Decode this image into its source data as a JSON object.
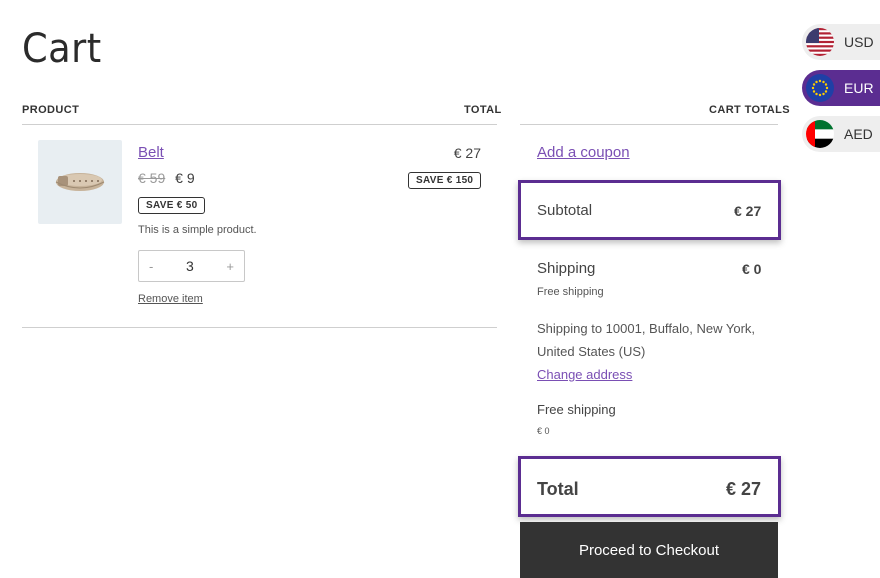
{
  "page": {
    "title": "Cart"
  },
  "table": {
    "col_product": "PRODUCT",
    "col_total": "TOTAL"
  },
  "item": {
    "name": "Belt",
    "price_old": "€ 59",
    "price_new": "€ 9",
    "save_badge": "SAVE € 50",
    "description": "This is a simple product.",
    "quantity": "3",
    "qty_minus": "-",
    "qty_plus": "+",
    "remove_label": "Remove item",
    "line_total": "€ 27",
    "line_save_badge": "SAVE € 150"
  },
  "totals": {
    "heading": "CART TOTALS",
    "coupon_link": "Add a coupon",
    "subtotal_label": "Subtotal",
    "subtotal_value": "€ 27",
    "shipping_label": "Shipping",
    "shipping_value": "€ 0",
    "shipping_method": "Free shipping",
    "shipping_to": "Shipping to 10001, Buffalo, New York, United States (US)",
    "change_address": "Change address",
    "option_label": "Free shipping",
    "option_price": "€ 0",
    "total_label": "Total",
    "total_value": "€ 27",
    "checkout_button": "Proceed to Checkout"
  },
  "currency_switcher": {
    "items": [
      {
        "code": "USD",
        "active": false
      },
      {
        "code": "EUR",
        "active": true
      },
      {
        "code": "AED",
        "active": false
      }
    ]
  },
  "colors": {
    "accent": "#5b2d91",
    "link": "#7a4fb4",
    "button": "#333333"
  }
}
